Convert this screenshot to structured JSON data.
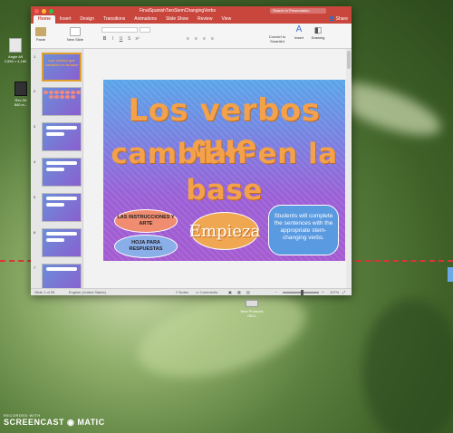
{
  "desktop": {
    "icon1": {
      "label": "Angie Alf\n2,556 × 4,180"
    },
    "icon2": {
      "label": "Rec Wi\n840.m..."
    },
    "hover_item": "New Products\nGELL",
    "recorder": {
      "line1": "RECORDED WITH",
      "line2": "SCREENCAST ◉ MATIC"
    }
  },
  "window": {
    "title": "FinalSpanishTwoStemChangingVerbs",
    "search_placeholder": "Search in Presentation",
    "share": "Share",
    "tabs": [
      "Home",
      "Insert",
      "Design",
      "Transitions",
      "Animations",
      "Slide Show",
      "Review",
      "View"
    ],
    "ribbon": {
      "paste": "Paste",
      "new_slide": "New Slide",
      "convert": "Convert to SmartArt",
      "insert": "Insert",
      "drawing": "Drawing"
    }
  },
  "thumbnails": [
    {
      "num": "1",
      "title": "Los verbos que cambian en la base"
    },
    {
      "num": "2",
      "title": ""
    },
    {
      "num": "3",
      "title": ""
    },
    {
      "num": "4",
      "title": ""
    },
    {
      "num": "5",
      "title": ""
    },
    {
      "num": "6",
      "title": ""
    },
    {
      "num": "7",
      "title": ""
    }
  ],
  "slide": {
    "title_line1": "Los verbos que",
    "title_line2": "cambian en la base",
    "btn_instructions": "LAS INSTRUCCIONES Y ARTE",
    "btn_answers": "HOJA PARA RESPUESTAS",
    "btn_start": "Empieza",
    "callout": "Students will complete the sentences with the appropriate stem-changing verbs."
  },
  "statusbar": {
    "slide_count": "Slide 1 of 35",
    "language": "English (United States)",
    "notes": "Notes",
    "comments": "Comments",
    "zoom": "107%"
  },
  "colors": {
    "ribbon_accent": "#c9463d",
    "title_orange": "#f3a14a",
    "callout_blue": "#5a9ae0"
  }
}
